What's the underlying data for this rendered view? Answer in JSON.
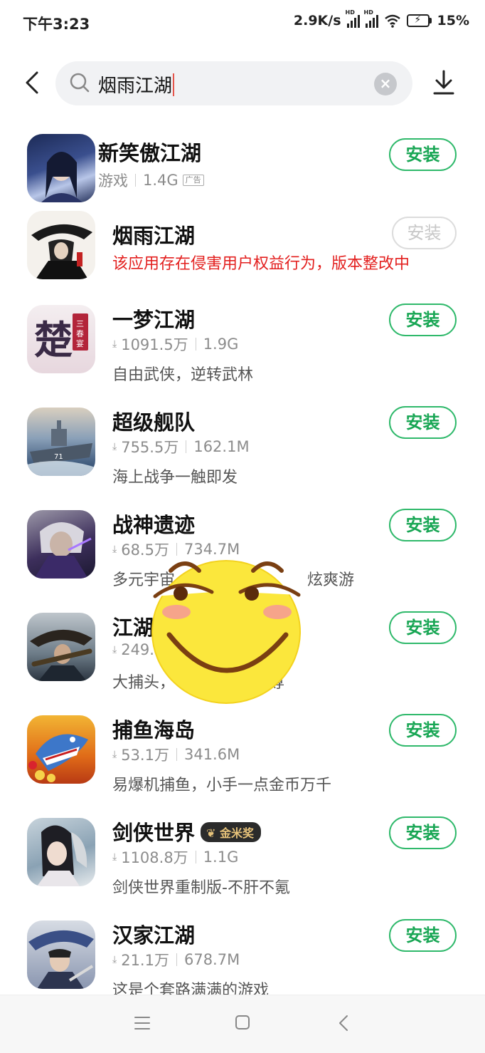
{
  "status_bar": {
    "time": "下午3:23",
    "speed": "2.9K/s",
    "hd1": "HD",
    "hd2": "HD",
    "battery": "15%"
  },
  "search": {
    "query": "烟雨江湖",
    "clear": "×"
  },
  "apps": [
    {
      "name": "新笑傲江湖",
      "category": "游戏",
      "size": "1.4G",
      "ad_label": "广告",
      "button": "安装"
    },
    {
      "name": "烟雨江湖",
      "warning": "该应用存在侵害用户权益行为，版本整改中",
      "button": "安装"
    },
    {
      "name": "一梦江湖",
      "downloads": "1091.5万",
      "size": "1.9G",
      "desc": "自由武侠，逆转武林",
      "button": "安装"
    },
    {
      "name": "超级舰队",
      "downloads": "755.5万",
      "size": "162.1M",
      "desc": "海上战争一触即发",
      "button": "安装"
    },
    {
      "name": "战神遗迹",
      "downloads": "68.5万",
      "size": "734.7M",
      "desc_start": "多元宇宙",
      "desc_end": "炫爽游",
      "button": "安装"
    },
    {
      "name": "江湖",
      "downloads": "249.",
      "desc_start": "大捕头，",
      "desc_end": "尊",
      "button": "安装"
    },
    {
      "name": "捕鱼海岛",
      "downloads": "53.1万",
      "size": "341.6M",
      "desc": "易爆机捕鱼，小手一点金币万千",
      "button": "安装"
    },
    {
      "name": "剑侠世界",
      "badge": "金米奖",
      "downloads": "1108.8万",
      "size": "1.1G",
      "desc": "剑侠世界重制版-不肝不氪",
      "button": "安装"
    },
    {
      "name": "汉家江湖",
      "downloads": "21.1万",
      "size": "678.7M",
      "desc": "这是个套路满满的游戏",
      "button": "安装"
    }
  ],
  "colors": {
    "install_green": "#18a654",
    "warning_red": "#e3201f"
  }
}
